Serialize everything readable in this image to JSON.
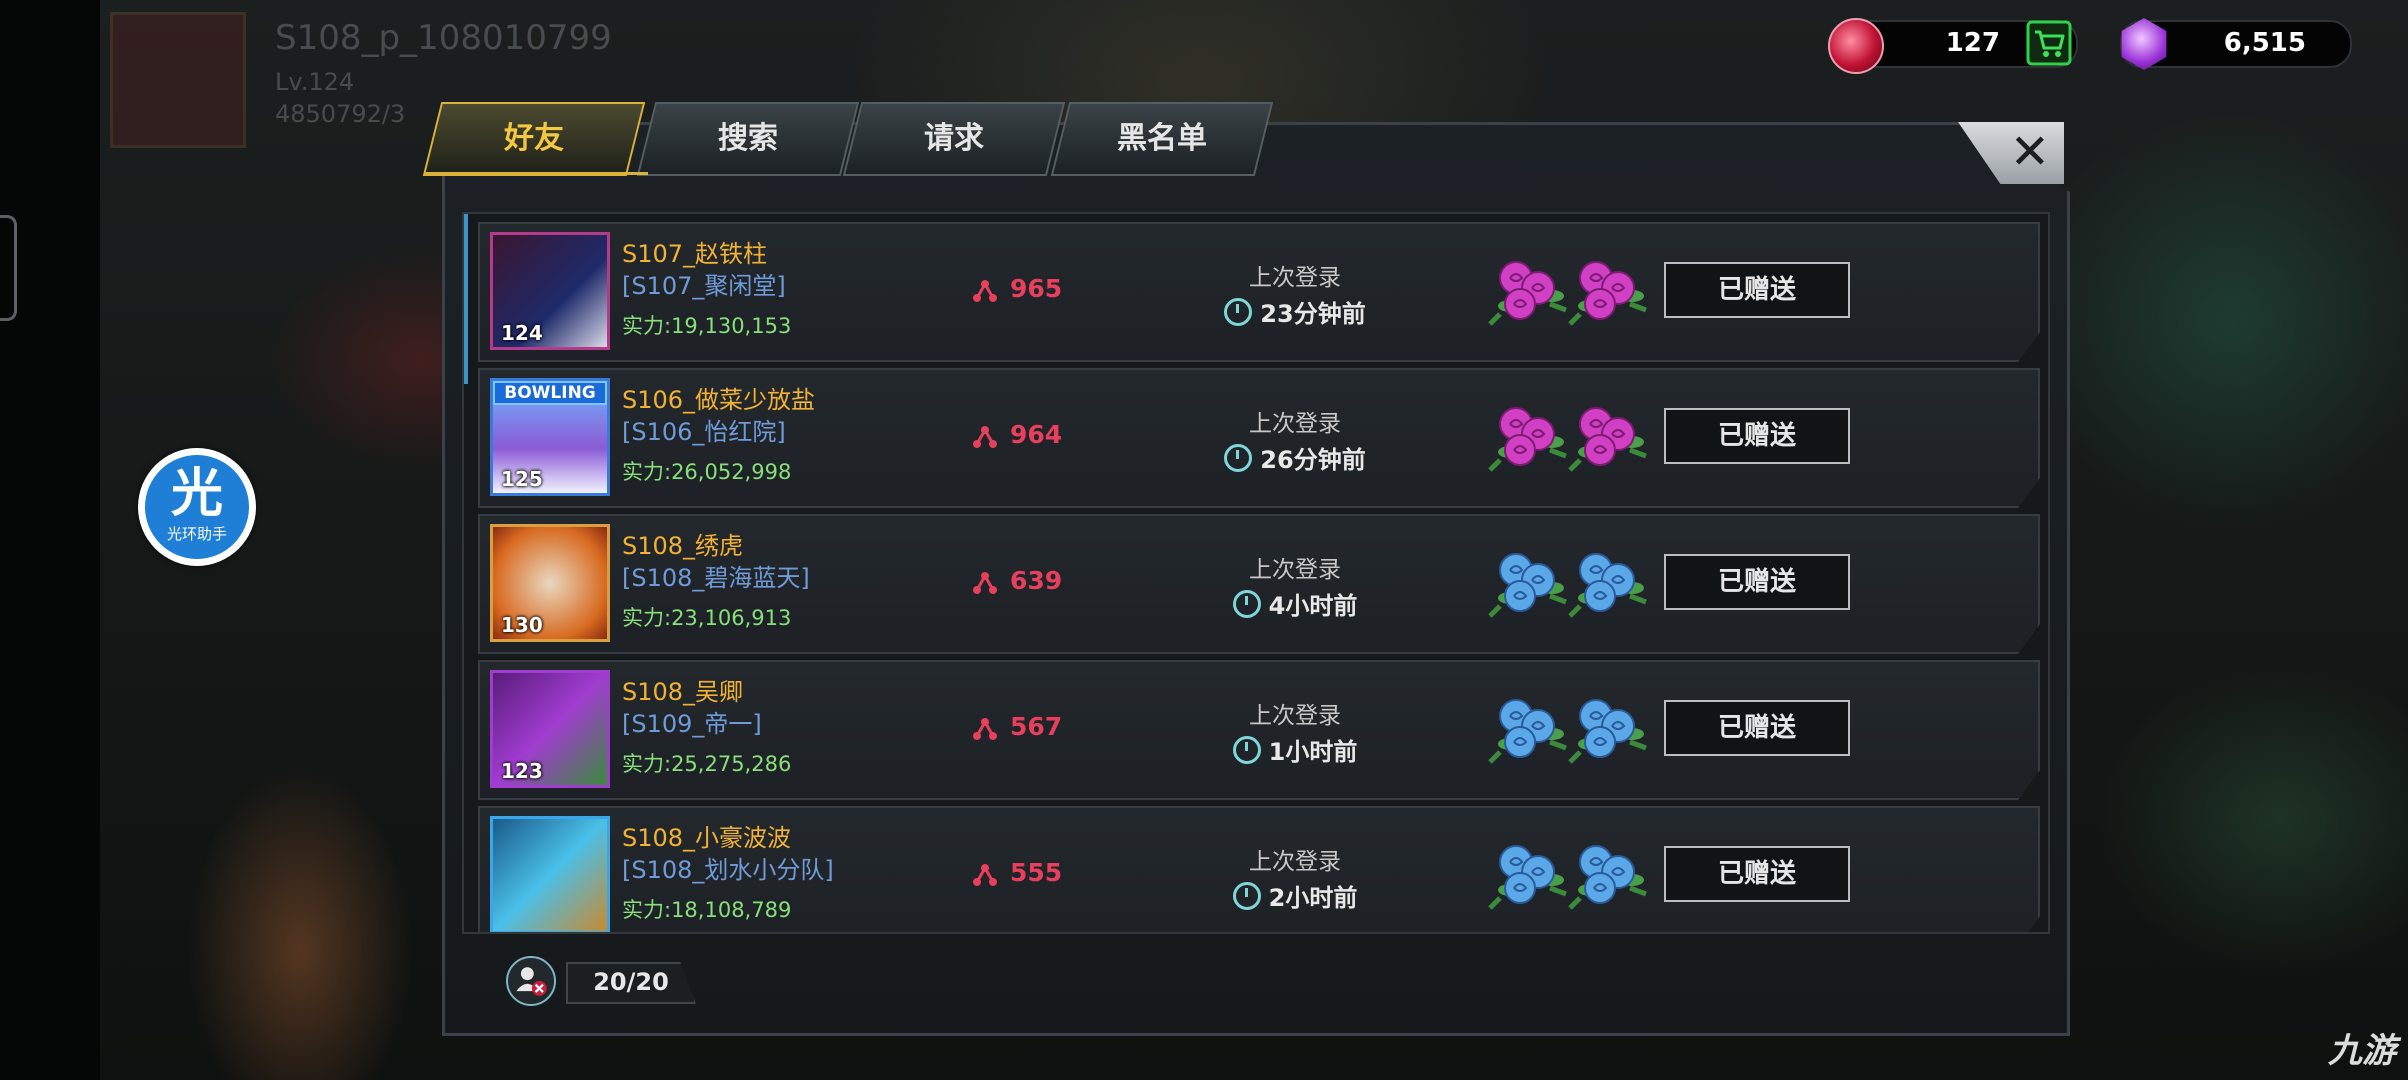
{
  "background": {
    "player_name": "S108_p_108010799",
    "player_level": "Lv.124",
    "player_id": "4850792/3"
  },
  "helper": {
    "glyph": "光",
    "label": "光环助手"
  },
  "currency": {
    "ruby": {
      "icon": "ruby-gem-icon",
      "value": "127"
    },
    "crystal": {
      "icon": "purple-hex-crystal-icon",
      "value": "6,515"
    }
  },
  "tabs": [
    {
      "label": "好友",
      "active": true
    },
    {
      "label": "搜索",
      "active": false
    },
    {
      "label": "请求",
      "active": false
    },
    {
      "label": "黑名单",
      "active": false
    }
  ],
  "close_label": "✕",
  "friends": [
    {
      "name": "S107_赵铁柱",
      "guild": "[S107_聚闲堂]",
      "power": "实力:19,130,153",
      "level": "124",
      "points": "965",
      "last_login_label": "上次登录",
      "last_login": "23分钟前",
      "rose_color": "purple",
      "sent_label": "已赠送"
    },
    {
      "name": "S106_做菜少放盐",
      "guild": "[S106_怡红院]",
      "power": "实力:26,052,998",
      "level": "125",
      "points": "964",
      "last_login_label": "上次登录",
      "last_login": "26分钟前",
      "rose_color": "purple",
      "sent_label": "已赠送",
      "avatar_badge": "BOWLING"
    },
    {
      "name": "S108_绣虎",
      "guild": "[S108_碧海蓝天]",
      "power": "实力:23,106,913",
      "level": "130",
      "points": "639",
      "last_login_label": "上次登录",
      "last_login": "4小时前",
      "rose_color": "blue",
      "sent_label": "已赠送"
    },
    {
      "name": "S108_吴卿",
      "guild": "[S109_帝一]",
      "power": "实力:25,275,286",
      "level": "123",
      "points": "567",
      "last_login_label": "上次登录",
      "last_login": "1小时前",
      "rose_color": "blue",
      "sent_label": "已赠送"
    },
    {
      "name": "S108_小豪波波",
      "guild": "[S108_划水小分队]",
      "power": "实力:18,108,789",
      "level": "",
      "points": "555",
      "last_login_label": "上次登录",
      "last_login": "2小时前",
      "rose_color": "blue",
      "sent_label": "已赠送"
    }
  ],
  "footer": {
    "icon": "remove-friend-icon",
    "count": "20/20"
  },
  "watermark": "九游",
  "colors": {
    "accent_gold": "#f5c842",
    "name": "#f2b233",
    "guild": "#6f9bd8",
    "power": "#88e07a",
    "points": "#e8405c",
    "rose_purple": "#d13fc4",
    "rose_blue": "#5aa8e8"
  }
}
